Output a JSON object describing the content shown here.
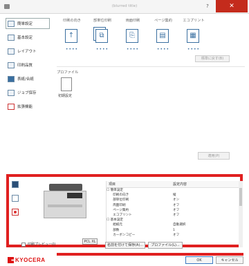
{
  "titlebar": {
    "title": "(blurred title)",
    "help": "?",
    "close": "✕"
  },
  "sidebar": {
    "items": [
      {
        "label": "簡単設定"
      },
      {
        "label": "基本設定"
      },
      {
        "label": "レイアウト"
      },
      {
        "label": "印刷品質"
      },
      {
        "label": "表紙/合紙"
      },
      {
        "label": "ジョブ保存"
      },
      {
        "label": "拡張機能"
      }
    ]
  },
  "quick": {
    "tabs": [
      {
        "label": "印刷の向き",
        "glyph": "↑"
      },
      {
        "label": "部単位印刷",
        "glyph": "⧉"
      },
      {
        "label": "両面印刷",
        "glyph": "⎘"
      },
      {
        "label": "ページ集約",
        "glyph": "▤"
      },
      {
        "label": "エコプリント",
        "glyph": "▦"
      }
    ],
    "dots": "••••",
    "reset_label": "標準に戻す(B)",
    "profile_section_label": "プロファイル",
    "profile_tile_label": "初期設定",
    "apply_label": "適用(P)"
  },
  "preview": {
    "pdl_badge": "PCL XL",
    "table": {
      "header_item": "項目",
      "header_value": "設定内容",
      "rows": [
        {
          "k": "☐ 簡単設定",
          "v": ""
        },
        {
          "k": "　　印刷の向き",
          "v": "縦"
        },
        {
          "k": "　　部単位印刷",
          "v": "オン"
        },
        {
          "k": "　　両面印刷",
          "v": "オフ"
        },
        {
          "k": "　　ページ集約",
          "v": "オフ"
        },
        {
          "k": "　　エコプリント",
          "v": "オフ"
        },
        {
          "k": "☐ 基本設定",
          "v": ""
        },
        {
          "k": "　　給紙元",
          "v": "自動選択"
        },
        {
          "k": "　　部数",
          "v": "1"
        },
        {
          "k": "　　カーボンコピー",
          "v": "オフ"
        }
      ]
    },
    "checkbox_label": "印刷プレビュー(I)"
  },
  "actions": {
    "save_as_label": "名前を付けて保存(A)...",
    "profile_label": "プロファイル(L)..."
  },
  "footer": {
    "brand": "KYOCERA",
    "ok_label": "OK",
    "cancel_label": "キャンセル"
  }
}
